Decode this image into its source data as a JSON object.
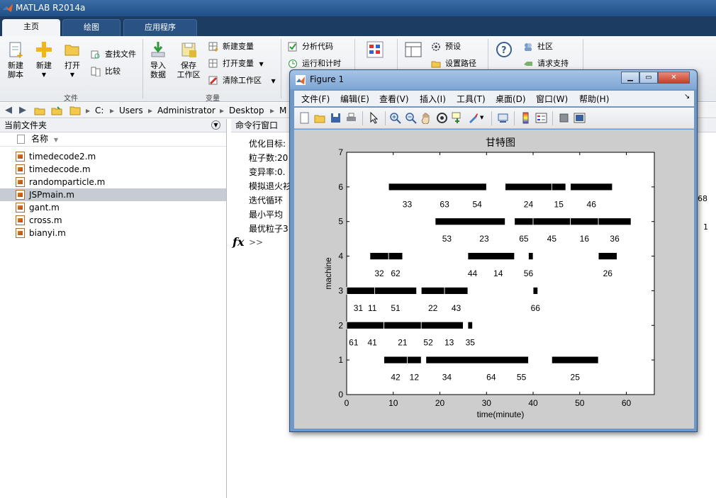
{
  "app": {
    "title": "MATLAB R2014a"
  },
  "tabs": [
    {
      "label": "主页"
    },
    {
      "label": "绘图"
    },
    {
      "label": "应用程序"
    }
  ],
  "ribbon": {
    "file": {
      "new_script": "新建\n脚本",
      "new": "新建",
      "open": "打开",
      "find_files": "查找文件",
      "compare": "比较",
      "group": "文件"
    },
    "variable": {
      "import": "导入\n数据",
      "save_ws": "保存\n工作区",
      "new_var": "新建变量",
      "open_var": "打开变量",
      "clear_ws": "清除工作区",
      "group": "变量"
    },
    "code": {
      "analyze": "分析代码",
      "run_time": "运行和计时"
    },
    "env": {
      "prefs": "预设",
      "set_path": "设置路径"
    },
    "resources": {
      "community": "社区",
      "request_support": "请求支持"
    }
  },
  "address": {
    "parts": [
      "C:",
      "Users",
      "Administrator",
      "Desktop",
      "M"
    ]
  },
  "left_panel": {
    "title": "当前文件夹",
    "col_name": "名称",
    "files": [
      {
        "name": "timedecode2.m",
        "selected": false
      },
      {
        "name": "timedecode.m",
        "selected": false
      },
      {
        "name": "randomparticle.m",
        "selected": false
      },
      {
        "name": "JSPmain.m",
        "selected": true
      },
      {
        "name": "gant.m",
        "selected": false
      },
      {
        "name": "cross.m",
        "selected": false
      },
      {
        "name": "bianyi.m",
        "selected": false
      }
    ]
  },
  "command_window": {
    "title": "命令行窗口",
    "lines": [
      "优化目标:",
      "粒子数:20",
      "变异率:0.",
      "模拟退火衫",
      "迭代循环",
      "最小平均",
      "最优粒子3"
    ],
    "right_values": [
      "68",
      "1"
    ],
    "prompt": ">>",
    "fx": "fx"
  },
  "figure": {
    "title": "Figure 1",
    "menu": [
      "文件(F)",
      "编辑(E)",
      "查看(V)",
      "插入(I)",
      "工具(T)",
      "桌面(D)",
      "窗口(W)",
      "帮助(H)"
    ],
    "menu_arrow": "↘"
  },
  "chart_data": {
    "type": "gantt",
    "title": "甘特图",
    "xlabel": "time(minute)",
    "ylabel": "machine",
    "xlim": [
      0,
      66
    ],
    "ylim": [
      0,
      7
    ],
    "xticks": [
      0,
      10,
      20,
      30,
      40,
      50,
      60
    ],
    "yticks": [
      0,
      1,
      2,
      3,
      4,
      5,
      6,
      7
    ],
    "bar_color": "#000000",
    "bars": [
      {
        "machine": 6,
        "start": 9,
        "end": 30
      },
      {
        "machine": 6,
        "start": 34,
        "end": 44
      },
      {
        "machine": 6,
        "start": 44,
        "end": 47
      },
      {
        "machine": 6,
        "start": 48,
        "end": 57
      },
      {
        "machine": 5,
        "start": 19,
        "end": 34
      },
      {
        "machine": 5,
        "start": 36,
        "end": 40
      },
      {
        "machine": 5,
        "start": 40,
        "end": 48
      },
      {
        "machine": 5,
        "start": 48,
        "end": 54
      },
      {
        "machine": 5,
        "start": 54,
        "end": 61
      },
      {
        "machine": 4,
        "start": 5,
        "end": 9
      },
      {
        "machine": 4,
        "start": 9,
        "end": 12
      },
      {
        "machine": 4,
        "start": 26,
        "end": 36
      },
      {
        "machine": 4,
        "start": 39,
        "end": 40
      },
      {
        "machine": 4,
        "start": 54,
        "end": 58
      },
      {
        "machine": 3,
        "start": 0,
        "end": 6
      },
      {
        "machine": 3,
        "start": 6,
        "end": 15
      },
      {
        "machine": 3,
        "start": 16,
        "end": 21
      },
      {
        "machine": 3,
        "start": 21,
        "end": 26
      },
      {
        "machine": 3,
        "start": 40,
        "end": 41
      },
      {
        "machine": 2,
        "start": 0,
        "end": 8
      },
      {
        "machine": 2,
        "start": 8,
        "end": 16
      },
      {
        "machine": 2,
        "start": 16,
        "end": 25
      },
      {
        "machine": 2,
        "start": 26,
        "end": 27
      },
      {
        "machine": 1,
        "start": 8,
        "end": 13
      },
      {
        "machine": 1,
        "start": 13,
        "end": 16
      },
      {
        "machine": 1,
        "start": 17,
        "end": 39
      },
      {
        "machine": 1,
        "start": 44,
        "end": 54
      }
    ],
    "labels": [
      {
        "machine": 6,
        "x": 13,
        "text": "33"
      },
      {
        "machine": 6,
        "x": 21,
        "text": "63"
      },
      {
        "machine": 6,
        "x": 28,
        "text": "54"
      },
      {
        "machine": 6,
        "x": 39,
        "text": "24"
      },
      {
        "machine": 6,
        "x": 45.5,
        "text": "15"
      },
      {
        "machine": 6,
        "x": 52.5,
        "text": "46"
      },
      {
        "machine": 5,
        "x": 21.5,
        "text": "53"
      },
      {
        "machine": 5,
        "x": 29.5,
        "text": "23"
      },
      {
        "machine": 5,
        "x": 38,
        "text": "65"
      },
      {
        "machine": 5,
        "x": 44,
        "text": "45"
      },
      {
        "machine": 5,
        "x": 51,
        "text": "16"
      },
      {
        "machine": 5,
        "x": 57.5,
        "text": "36"
      },
      {
        "machine": 4,
        "x": 7,
        "text": "32"
      },
      {
        "machine": 4,
        "x": 10.5,
        "text": "62"
      },
      {
        "machine": 4,
        "x": 27,
        "text": "44"
      },
      {
        "machine": 4,
        "x": 32.5,
        "text": "14"
      },
      {
        "machine": 4,
        "x": 39,
        "text": "56"
      },
      {
        "machine": 4,
        "x": 56,
        "text": "26"
      },
      {
        "machine": 3,
        "x": 2.5,
        "text": "31"
      },
      {
        "machine": 3,
        "x": 5.5,
        "text": "11"
      },
      {
        "machine": 3,
        "x": 10.5,
        "text": "51"
      },
      {
        "machine": 3,
        "x": 18.5,
        "text": "22"
      },
      {
        "machine": 3,
        "x": 23.5,
        "text": "43"
      },
      {
        "machine": 3,
        "x": 40.5,
        "text": "66"
      },
      {
        "machine": 2,
        "x": 1.5,
        "text": "61"
      },
      {
        "machine": 2,
        "x": 5.5,
        "text": "41"
      },
      {
        "machine": 2,
        "x": 12,
        "text": "21"
      },
      {
        "machine": 2,
        "x": 17.5,
        "text": "52"
      },
      {
        "machine": 2,
        "x": 22,
        "text": "13"
      },
      {
        "machine": 2,
        "x": 26.5,
        "text": "35"
      },
      {
        "machine": 1,
        "x": 10.5,
        "text": "42"
      },
      {
        "machine": 1,
        "x": 14.5,
        "text": "12"
      },
      {
        "machine": 1,
        "x": 21.5,
        "text": "34"
      },
      {
        "machine": 1,
        "x": 31,
        "text": "64"
      },
      {
        "machine": 1,
        "x": 37.5,
        "text": "55"
      },
      {
        "machine": 1,
        "x": 49,
        "text": "25"
      }
    ]
  }
}
